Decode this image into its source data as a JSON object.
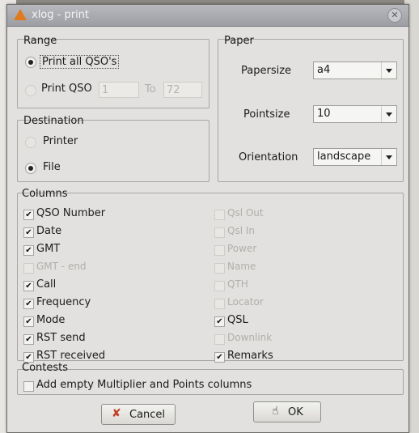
{
  "window": {
    "title": "xlog - print",
    "close_icon": "close-icon"
  },
  "range": {
    "legend": "Range",
    "print_all": {
      "label": "Print all QSO's",
      "selected": true
    },
    "print_qso": {
      "label": "Print QSO",
      "selected": false,
      "from": "1",
      "to_label": "To",
      "to": "72"
    }
  },
  "destination": {
    "legend": "Destination",
    "printer": {
      "label": "Printer",
      "selected": false
    },
    "file": {
      "label": "File",
      "selected": true
    }
  },
  "paper": {
    "legend": "Paper",
    "papersize": {
      "label": "Papersize",
      "value": "a4"
    },
    "pointsize": {
      "label": "Pointsize",
      "value": "10"
    },
    "orientation": {
      "label": "Orientation",
      "value": "landscape"
    }
  },
  "columns": {
    "legend": "Columns",
    "left": [
      {
        "label": "QSO Number",
        "checked": true,
        "enabled": true
      },
      {
        "label": "Date",
        "checked": true,
        "enabled": true
      },
      {
        "label": "GMT",
        "checked": true,
        "enabled": true
      },
      {
        "label": "GMT - end",
        "checked": false,
        "enabled": false
      },
      {
        "label": "Call",
        "checked": true,
        "enabled": true
      },
      {
        "label": "Frequency",
        "checked": true,
        "enabled": true
      },
      {
        "label": "Mode",
        "checked": true,
        "enabled": true
      },
      {
        "label": "RST send",
        "checked": true,
        "enabled": true
      },
      {
        "label": "RST received",
        "checked": true,
        "enabled": true
      }
    ],
    "right": [
      {
        "label": "Qsl Out",
        "checked": false,
        "enabled": false
      },
      {
        "label": "Qsl In",
        "checked": false,
        "enabled": false
      },
      {
        "label": "Power",
        "checked": false,
        "enabled": false
      },
      {
        "label": "Name",
        "checked": false,
        "enabled": false
      },
      {
        "label": "QTH",
        "checked": false,
        "enabled": false
      },
      {
        "label": "Locator",
        "checked": false,
        "enabled": false
      },
      {
        "label": "QSL",
        "checked": true,
        "enabled": true
      },
      {
        "label": "Downlink",
        "checked": false,
        "enabled": false
      },
      {
        "label": "Remarks",
        "checked": true,
        "enabled": true
      }
    ]
  },
  "contests": {
    "legend": "Contests",
    "option": {
      "label": "Add empty Multiplier and Points columns",
      "checked": false
    }
  },
  "buttons": {
    "cancel": {
      "label": "Cancel",
      "icon": "cancel-x-icon"
    },
    "ok": {
      "label": "OK",
      "icon": "ok-hand-icon"
    }
  }
}
